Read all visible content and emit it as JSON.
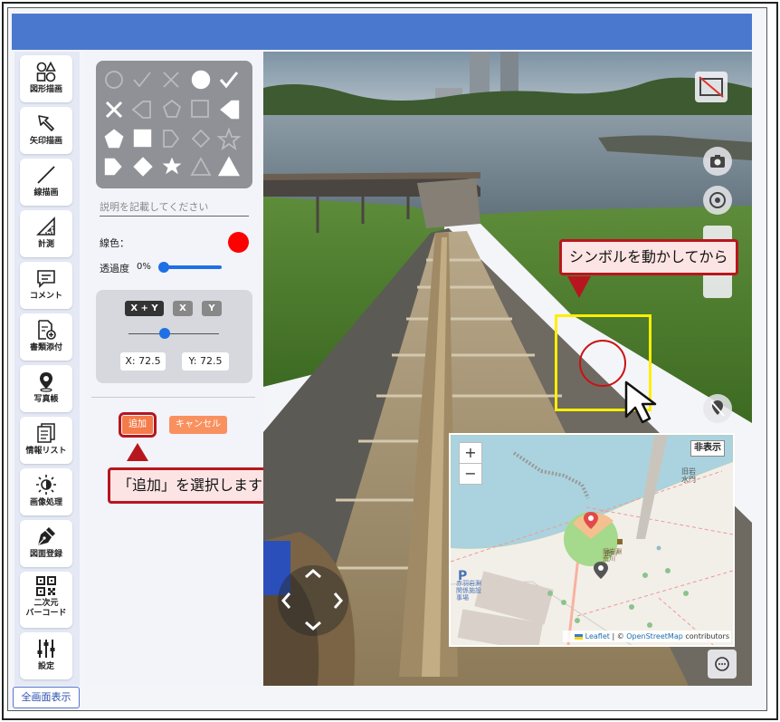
{
  "sidebar": {
    "items": [
      {
        "label": "図形描画",
        "icon": "shapes-icon"
      },
      {
        "label": "矢印描画",
        "icon": "arrow-icon"
      },
      {
        "label": "線描画",
        "icon": "line-icon"
      },
      {
        "label": "計測",
        "icon": "ruler-icon"
      },
      {
        "label": "コメント",
        "icon": "comment-icon"
      },
      {
        "label": "書類添付",
        "icon": "document-attach-icon"
      },
      {
        "label": "写真帳",
        "icon": "map-pin-icon"
      },
      {
        "label": "情報リスト",
        "icon": "list-icon"
      },
      {
        "label": "画像処理",
        "icon": "brightness-icon"
      },
      {
        "label": "図面登録",
        "icon": "pen-nib-icon"
      },
      {
        "label": "二次元\nバーコード",
        "icon": "qr-code-icon"
      },
      {
        "label": "設定",
        "icon": "sliders-icon"
      }
    ],
    "fullscreen_label": "全画面表示"
  },
  "panel": {
    "description_placeholder": "説明を記載してください",
    "line_color_label": "線色：",
    "line_color": "#ff0000",
    "opacity_label": "透過度",
    "opacity_value": "0%",
    "xy_buttons": [
      "X + Y",
      "X",
      "Y"
    ],
    "x_value": "X:  72.5",
    "y_value": "Y:  72.5",
    "scale_fraction": 0.4,
    "add_label": "追加",
    "cancel_label": "キャンセル"
  },
  "callouts": {
    "move_symbol": "シンボルを動かしてから",
    "select_add": "「追加」を選択します"
  },
  "map": {
    "zoom_in": "+",
    "zoom_out": "−",
    "hide_label": "非表示",
    "attribution_leaflet": "Leaflet",
    "attribution_sep": " | © ",
    "attribution_osm": "OpenStreetMap",
    "attribution_tail": " contributors",
    "labels": {
      "kyu_tonegawa": "旧岩\n水門",
      "place_name": "旧岩淵\n荒川",
      "akabane": "赤羽岩淵\n関係施設\n事場",
      "parking": "P"
    }
  },
  "colors": {
    "topbar": "#4a78cf",
    "accent_red": "#b7161e",
    "callout_bg": "#fde4e4",
    "highlight_yellow": "#ffee00",
    "slider_blue": "#1f6fe5"
  }
}
